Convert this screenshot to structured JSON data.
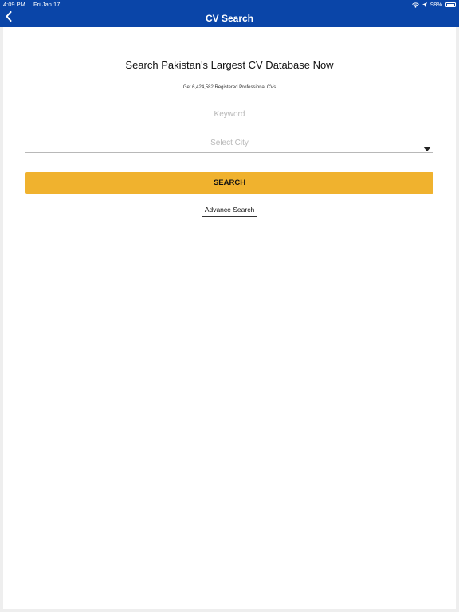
{
  "status_bar": {
    "time": "4:09 PM",
    "date": "Fri Jan 17",
    "battery": "98%",
    "icons": [
      "wifi-icon",
      "location-arrow-icon",
      "battery-icon"
    ]
  },
  "nav": {
    "title": "CV Search",
    "back_icon": "chevron-left-icon"
  },
  "main": {
    "headline": "Search Pakistan's Largest CV Database Now",
    "subheadline": "Get 6,424,582 Registered Professional CVs",
    "keyword_value": "",
    "keyword_placeholder": "Keyword",
    "city_placeholder": "Select City",
    "search_label": "SEARCH",
    "advance_search_label": "Advance Search"
  },
  "colors": {
    "brand_blue": "#0a45a8",
    "accent_yellow": "#f0b22e"
  }
}
